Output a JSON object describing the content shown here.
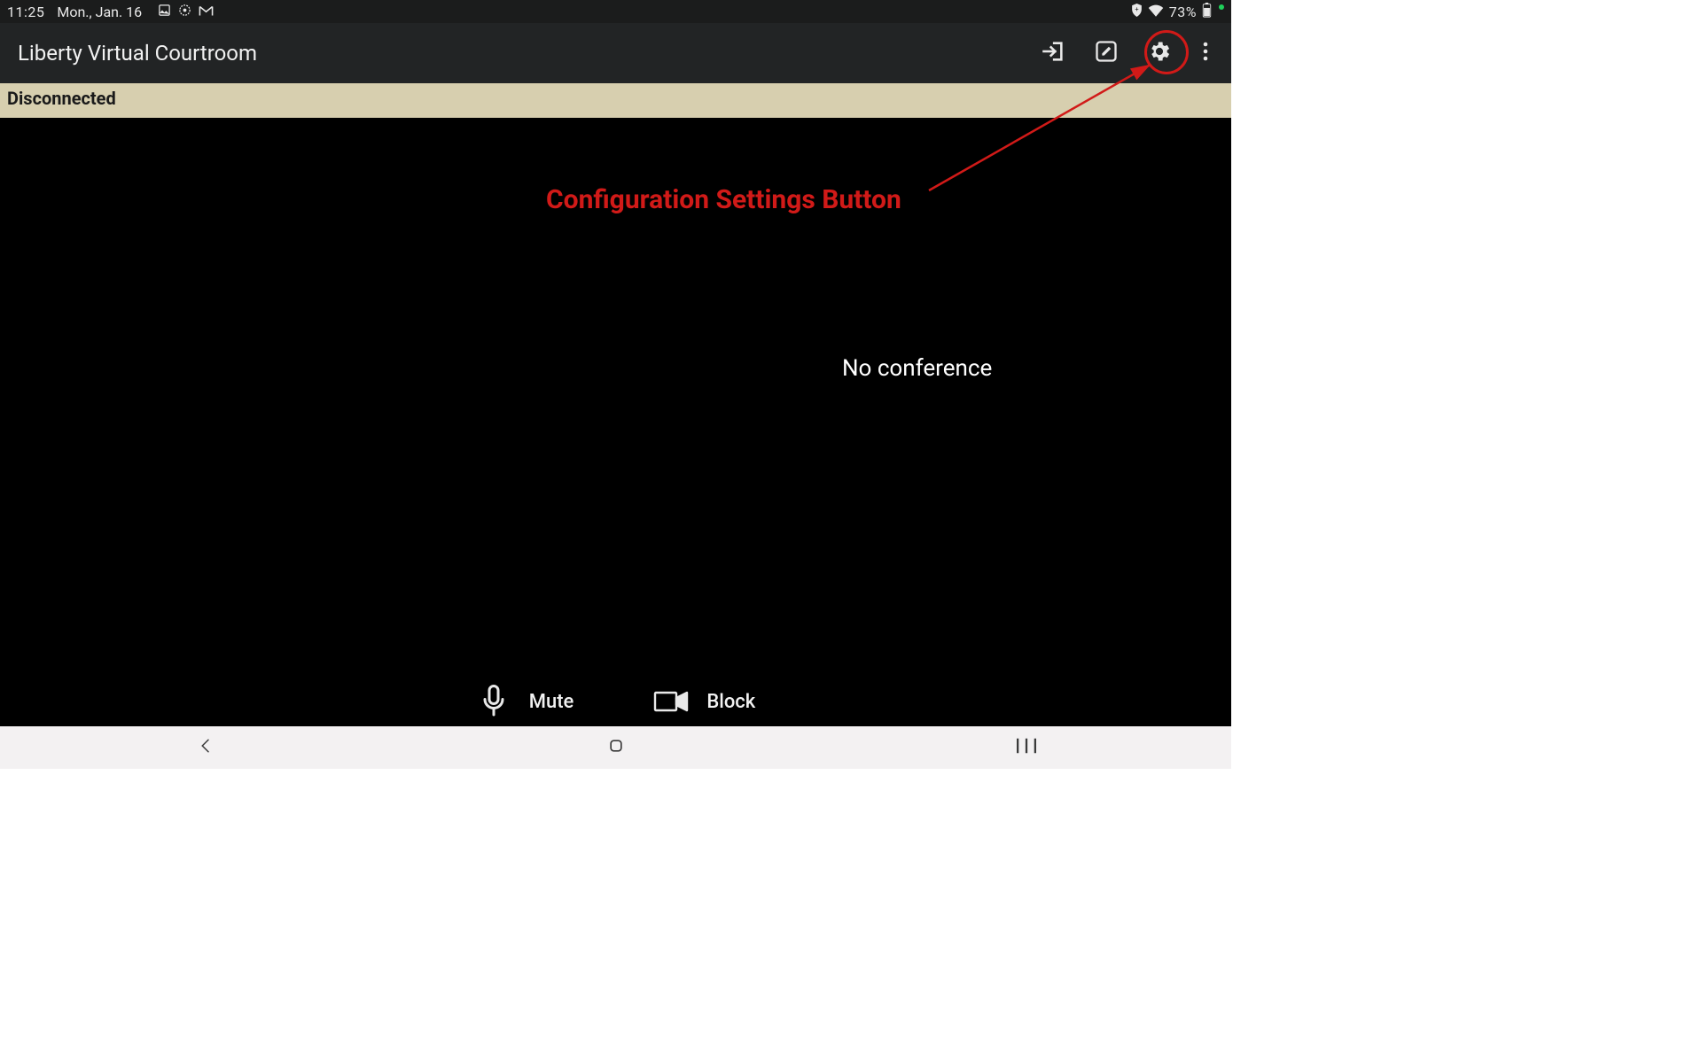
{
  "status_bar": {
    "time": "11:25",
    "date": "Mon., Jan. 16",
    "battery_pct": "73%",
    "icons_left": [
      "image-icon",
      "dnd-icon",
      "gmail-icon"
    ],
    "icons_right": [
      "shield-icon",
      "wifi-icon",
      "battery-icon"
    ]
  },
  "app_bar": {
    "title": "Liberty Virtual Courtroom",
    "actions": [
      "enter-icon",
      "edit-icon",
      "gear-icon",
      "more-icon"
    ]
  },
  "banner": {
    "text": "Disconnected"
  },
  "main": {
    "status_text": "No conference"
  },
  "annotation": {
    "label": "Configuration Settings Button",
    "color": "#d11a18"
  },
  "actions": {
    "mute_label": "Mute",
    "block_label": "Block"
  },
  "nav": {
    "items": [
      "back",
      "home",
      "recents"
    ]
  }
}
